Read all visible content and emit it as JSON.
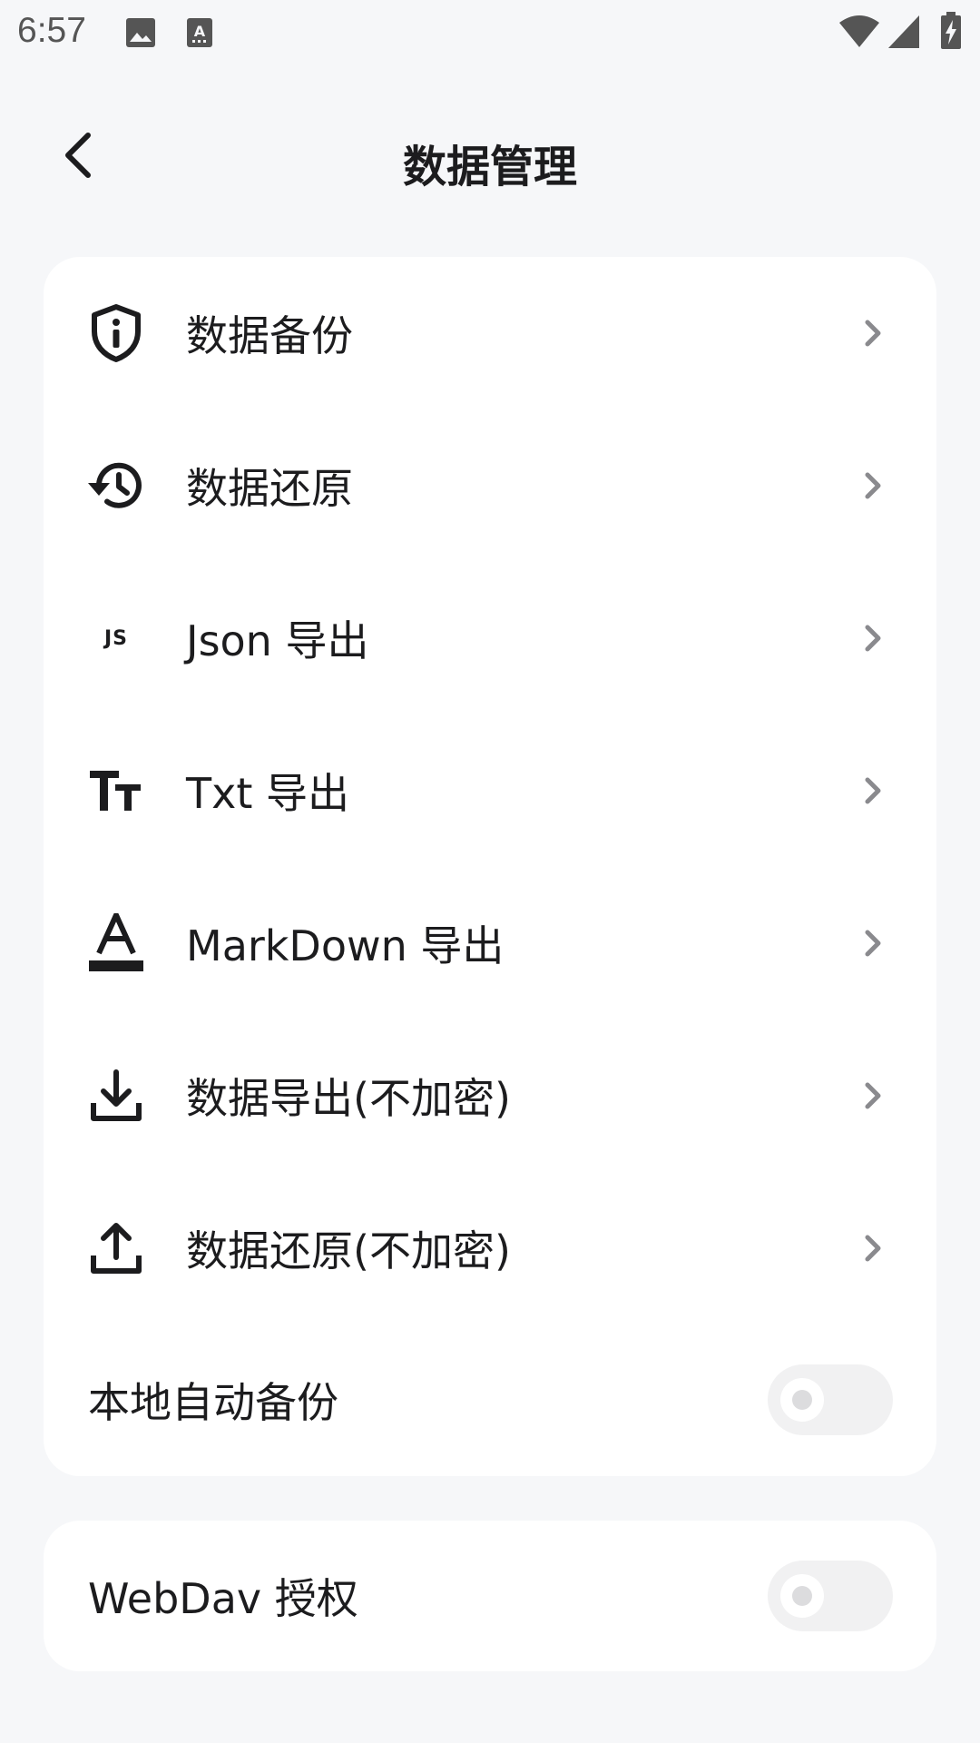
{
  "status_bar": {
    "time": "6:57",
    "icons": [
      "image-icon",
      "text-recognition-icon",
      "wifi-icon",
      "signal-icon",
      "battery-charging-icon"
    ]
  },
  "app_bar": {
    "title": "数据管理",
    "back_icon": "back-arrow-icon"
  },
  "menu": {
    "items": [
      {
        "label": "数据备份",
        "icon": "shield-info-icon"
      },
      {
        "label": "数据还原",
        "icon": "history-icon"
      },
      {
        "label": "Json 导出",
        "icon": "js-icon",
        "icon_text": "JS"
      },
      {
        "label": "Txt 导出",
        "icon": "text-size-icon"
      },
      {
        "label": "MarkDown 导出",
        "icon": "format-color-text-icon"
      },
      {
        "label": "数据导出(不加密)",
        "icon": "download-icon"
      },
      {
        "label": "数据还原(不加密)",
        "icon": "upload-icon"
      }
    ],
    "auto_backup": {
      "label": "本地自动备份",
      "enabled": false
    }
  },
  "webdav": {
    "label": "WebDav 授权",
    "enabled": false
  },
  "colors": {
    "background": "#f6f7f9",
    "card": "#ffffff",
    "text": "#1c1c1e",
    "chevron": "#8a8a8e",
    "toggle_track": "#f1f1f2"
  }
}
